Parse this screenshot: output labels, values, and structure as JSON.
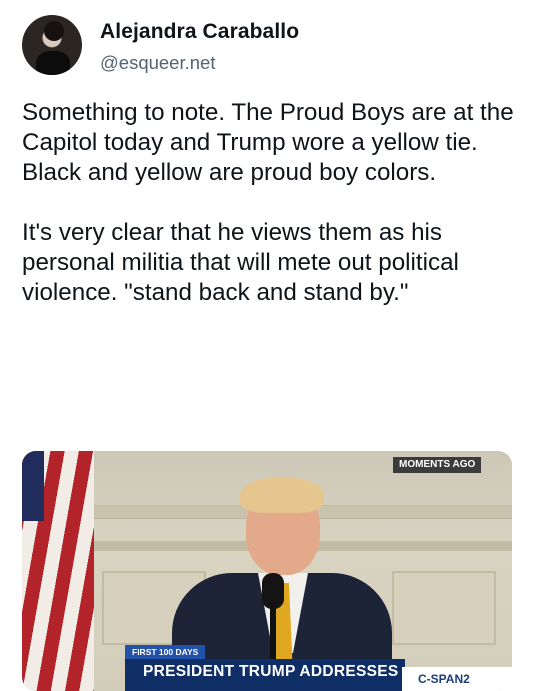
{
  "post": {
    "author_name": "Alejandra Caraballo",
    "author_handle": "@esqueer.net",
    "paragraphs": [
      "Something to note. The Proud Boys are at the Capitol today and Trump wore a yellow tie. Black and yellow are proud boy colors.",
      "It's very clear that he views them as his personal militia that will mete out political violence. \"stand back and stand by.\""
    ]
  },
  "media": {
    "corner_tag": "MOMENTS AGO",
    "chyron_tag": "FIRST 100 DAYS",
    "chyron_text": "PRESIDENT TRUMP ADDRESSES",
    "network_logo": "C-SPAN2"
  }
}
